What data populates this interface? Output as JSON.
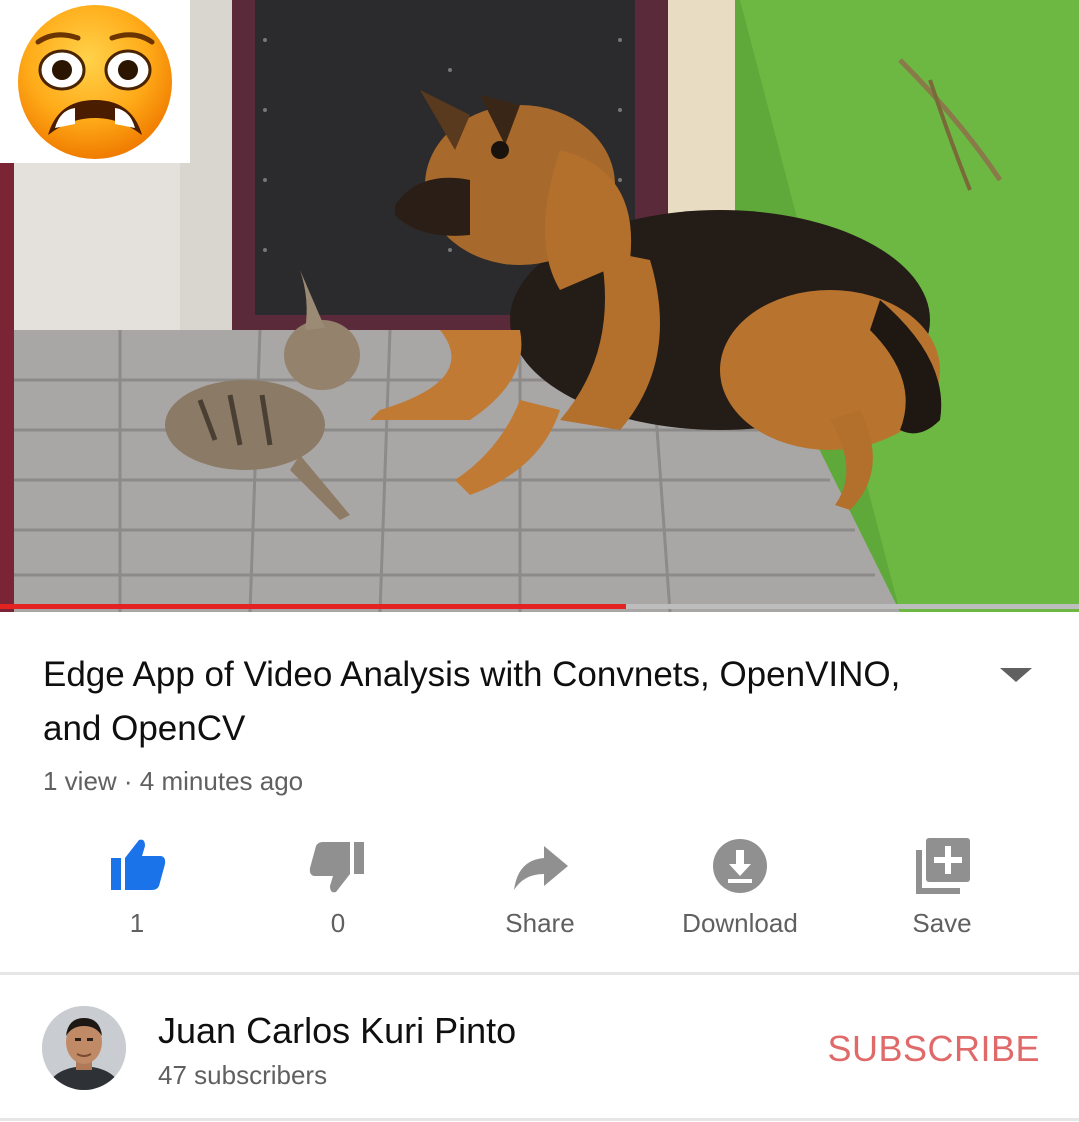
{
  "video": {
    "progress_fraction": 0.58,
    "title": "Edge App of Video Analysis with Convnets, OpenVINO, and OpenCV",
    "meta": "1 view · 4 minutes ago"
  },
  "actions": [
    {
      "name": "like",
      "label": "1",
      "icon": "thumbs-up-icon",
      "color": "#1a73e8"
    },
    {
      "name": "dislike",
      "label": "0",
      "icon": "thumbs-down-icon",
      "color": "#909090"
    },
    {
      "name": "share",
      "label": "Share",
      "icon": "share-icon",
      "color": "#909090"
    },
    {
      "name": "download",
      "label": "Download",
      "icon": "download-icon",
      "color": "#909090"
    },
    {
      "name": "save",
      "label": "Save",
      "icon": "playlist-add-icon",
      "color": "#909090"
    }
  ],
  "channel": {
    "name": "Juan Carlos Kuri Pinto",
    "subscribers": "47 subscribers",
    "subscribe_label": "SUBSCRIBE"
  },
  "colors": {
    "progress": "#e52222",
    "subscribe": "#e06a6a",
    "like_active": "#1a73e8"
  }
}
